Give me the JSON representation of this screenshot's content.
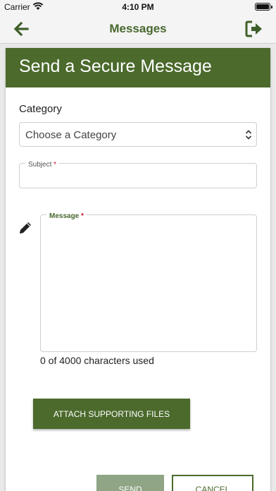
{
  "status_bar": {
    "carrier": "Carrier",
    "time": "4:10 PM"
  },
  "nav": {
    "title": "Messages"
  },
  "form": {
    "heading": "Send a Secure Message",
    "category_label": "Category",
    "category_value": "Choose a Category",
    "subject_label": "Subject",
    "message_label": "Message",
    "required_marker": "*",
    "char_count": "0 of 4000 characters used",
    "attach_label": "ATTACH SUPPORTING FILES",
    "send_label": "SEND",
    "cancel_label": "CANCEL"
  },
  "colors": {
    "primary": "#4b6a2c",
    "nav_title": "#49682f",
    "send_disabled": "#8fa585",
    "required": "#c8102e"
  },
  "icons": {
    "back": "arrow-left-icon",
    "logout": "sign-out-icon",
    "select": "chevron-up-down-icon",
    "edit": "pencil-icon",
    "wifi": "wifi-icon",
    "battery": "battery-icon"
  }
}
